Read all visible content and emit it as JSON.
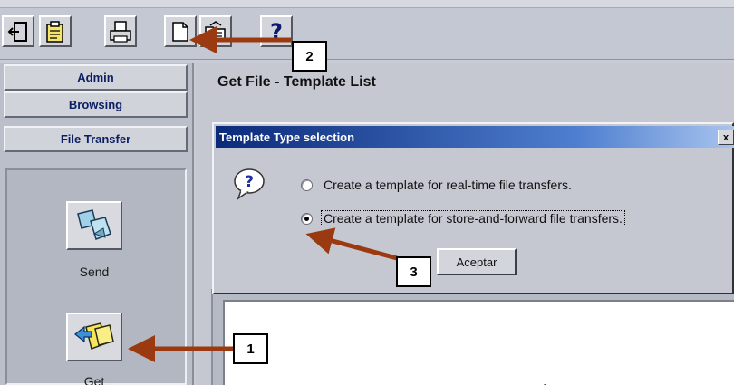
{
  "toolbar": {
    "buttons": [
      {
        "name": "exit-icon",
        "label": ""
      },
      {
        "name": "notes-icon",
        "label": ""
      },
      {
        "name": "printer-icon",
        "label": ""
      },
      {
        "name": "new-document-icon",
        "label": ""
      },
      {
        "name": "open-folder-icon",
        "label": ""
      },
      {
        "name": "help-icon",
        "label": "?"
      }
    ]
  },
  "nav": {
    "tabs": [
      {
        "label": "Admin"
      },
      {
        "label": "Browsing"
      },
      {
        "label": "File Transfer"
      }
    ],
    "tools": [
      {
        "label": "Send",
        "icon": "send-icon"
      },
      {
        "label": "Get",
        "icon": "get-icon"
      }
    ]
  },
  "main": {
    "title": "Get File - Template List"
  },
  "dialog": {
    "title": "Template Type selection",
    "close_label": "x",
    "icon": "question-icon",
    "options": [
      {
        "label": "Create a template for real-time file transfers.",
        "checked": false
      },
      {
        "label": "Create a template for store-and-forward file transfers.",
        "checked": true
      }
    ],
    "ok_label": "Aceptar"
  },
  "callouts": [
    "2",
    "1",
    "3"
  ],
  "colors": {
    "arrow": "#9b3a10",
    "title_gradient_start": "#0b2a7a",
    "title_gradient_end": "#a8c4ee",
    "nav_text": "#0b1e63"
  }
}
